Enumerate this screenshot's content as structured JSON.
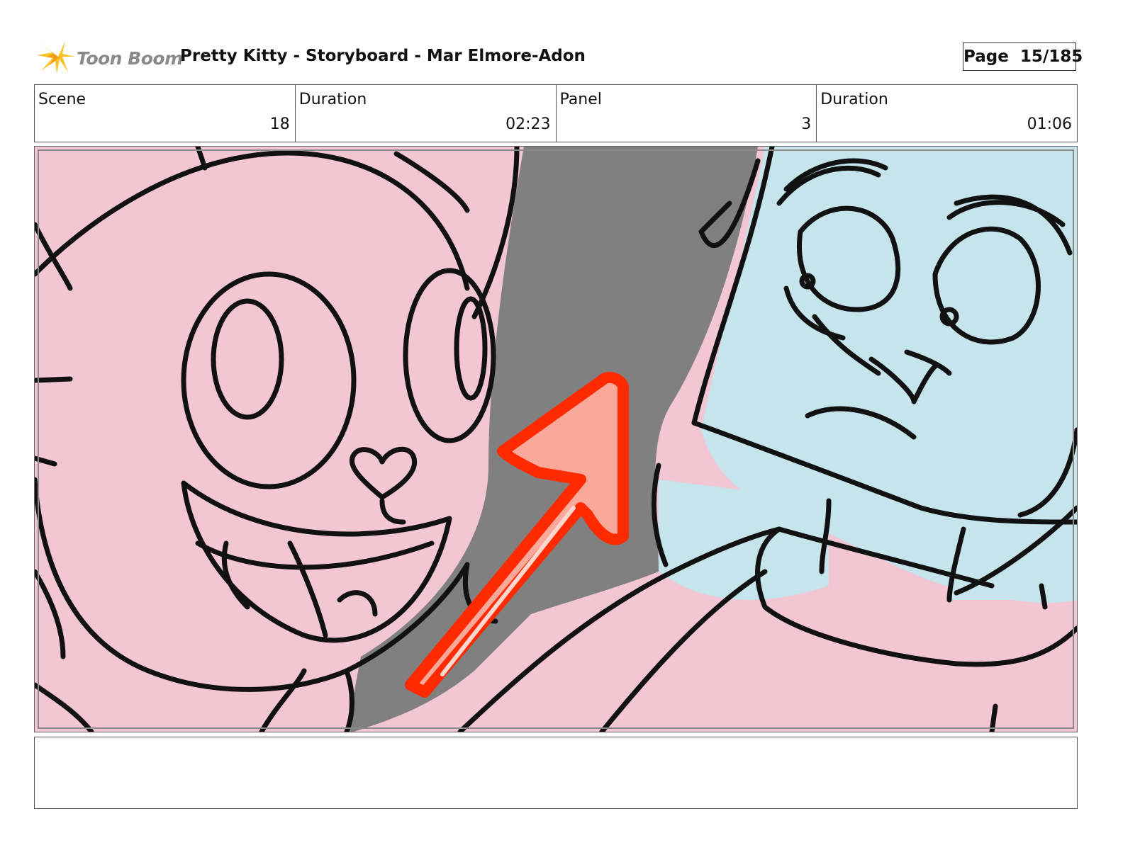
{
  "header": {
    "logo_text": "Toon Boom",
    "title": "Pretty Kitty - Storyboard - Mar Elmore-Adon",
    "page_label": "Page",
    "page_number": "15/185"
  },
  "info": {
    "scene_label": "Scene",
    "scene_value": "18",
    "scene_duration_label": "Duration",
    "scene_duration_value": "02:23",
    "panel_label": "Panel",
    "panel_value": "3",
    "panel_duration_label": "Duration",
    "panel_duration_value": "01:06"
  },
  "colors": {
    "pink": "#f2c6d2",
    "blue": "#c5e4ec",
    "gray": "#808080",
    "arrow_red": "#ff2a00",
    "arrow_fill": "#f9a899",
    "logo_yellow": "#f7c325"
  },
  "icons": {
    "logo": "starburst-icon",
    "arrow": "arrow-up-right-icon"
  }
}
